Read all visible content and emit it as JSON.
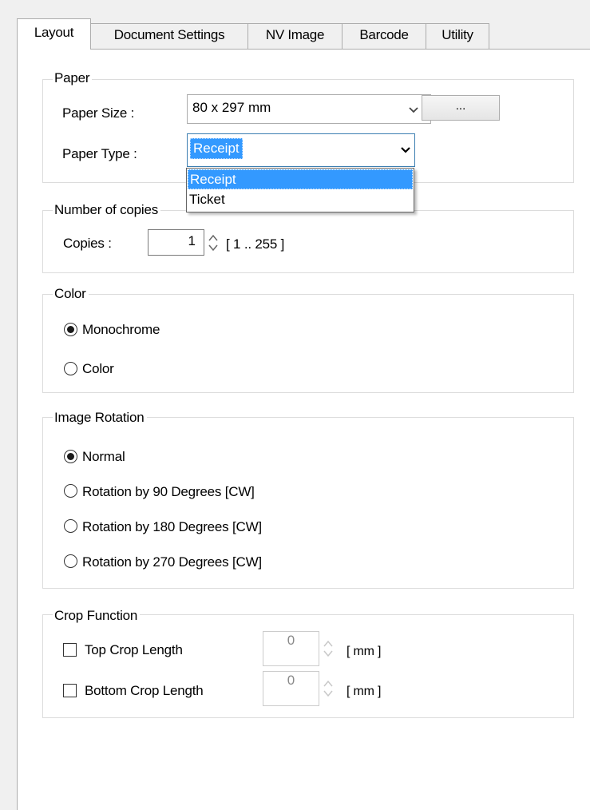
{
  "tabs": [
    {
      "label": "Layout"
    },
    {
      "label": "Document Settings"
    },
    {
      "label": "NV Image"
    },
    {
      "label": "Barcode"
    },
    {
      "label": "Utility"
    }
  ],
  "paper": {
    "legend": "Paper",
    "size_label": "Paper Size :",
    "size_value": "80 x 297 mm",
    "browse_label": "...",
    "type_label": "Paper Type :",
    "type_value": "Receipt",
    "type_options": [
      "Receipt",
      "Ticket"
    ]
  },
  "copies": {
    "legend": "Number of copies",
    "label": "Copies :",
    "value": "1",
    "range": "[ 1 .. 255 ]"
  },
  "color": {
    "legend": "Color",
    "options": [
      {
        "label": "Monochrome",
        "checked": true
      },
      {
        "label": "Color",
        "checked": false
      }
    ]
  },
  "rotation": {
    "legend": "Image Rotation",
    "options": [
      {
        "label": "Normal",
        "checked": true
      },
      {
        "label": "Rotation by 90 Degrees [CW]",
        "checked": false
      },
      {
        "label": "Rotation by 180 Degrees [CW]",
        "checked": false
      },
      {
        "label": "Rotation by 270 Degrees [CW]",
        "checked": false
      }
    ]
  },
  "crop": {
    "legend": "Crop Function",
    "top_label": "Top Crop Length",
    "top_value": "0",
    "top_unit": "[ mm ]",
    "bottom_label": "Bottom Crop Length",
    "bottom_value": "0",
    "bottom_unit": "[ mm ]"
  },
  "colors": {
    "selection": "#3399ff",
    "focus_border": "#3c7fb1",
    "window_bg": "#f0f0f0"
  }
}
